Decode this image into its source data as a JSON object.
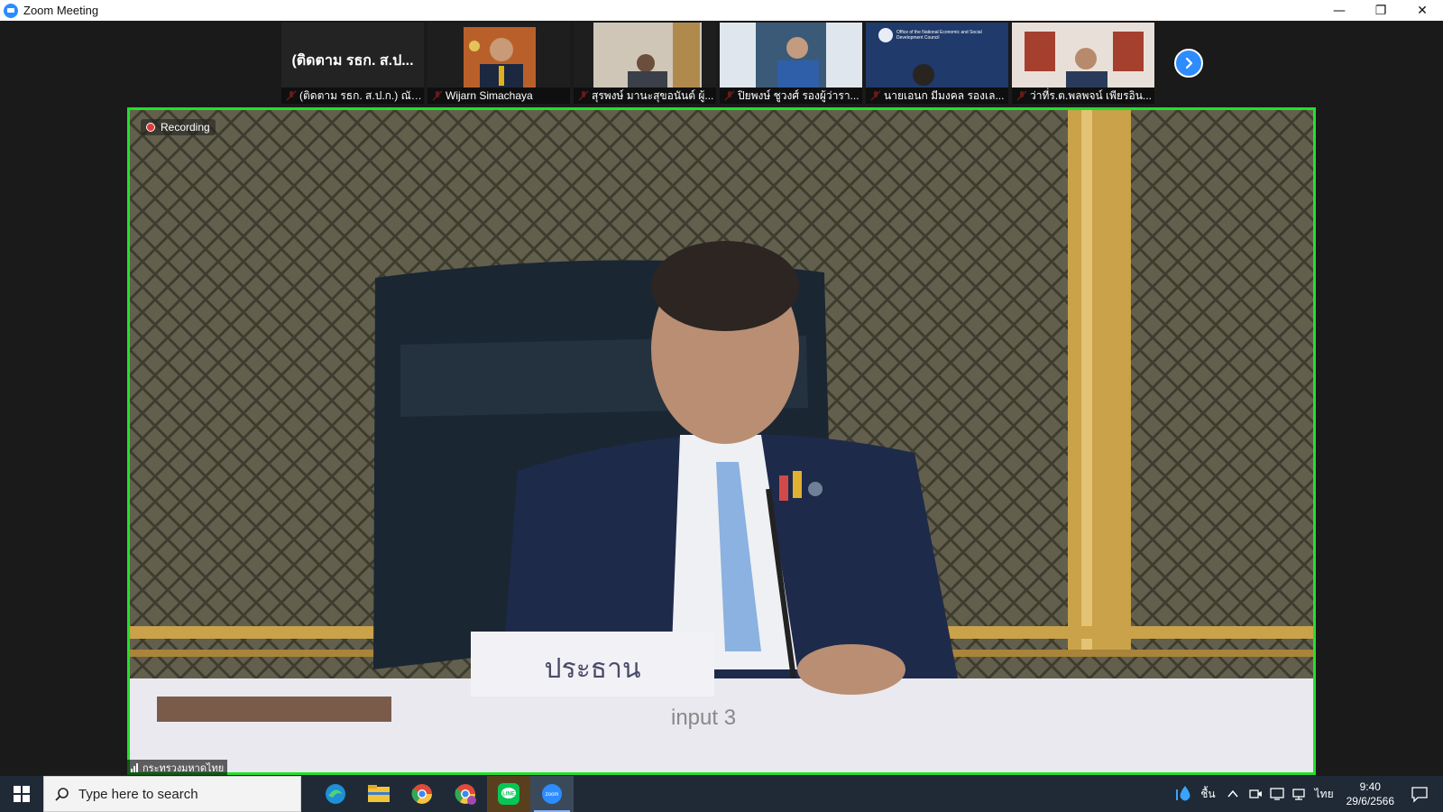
{
  "window": {
    "title": "Zoom Meeting",
    "minimize_glyph": "—",
    "restore_glyph": "❐",
    "close_glyph": "✕"
  },
  "thumbnails": [
    {
      "name_overlay": "(ติดตาม รธก. ส.ป...",
      "label": "(ติดตาม รธก. ส.ป.ก.) ณัฐ...",
      "muted": true,
      "video": false
    },
    {
      "label": "Wijarn Simachaya",
      "muted": true,
      "video": true
    },
    {
      "label": "สุรพงษ์ มานะสุขอนันต์ ผู้...",
      "muted": true,
      "video": true
    },
    {
      "label": "ปิยพงษ์ ชูวงศ์ รองผู้ว่ารา...",
      "muted": true,
      "video": true
    },
    {
      "label": "นายเอนก มีมงคล รองเล...",
      "muted": true,
      "video": true,
      "banner": "Office of the National Economic and Social Development Council"
    },
    {
      "label": "ว่าที่ร.ต.พลพจน์ เพียรอิน...",
      "muted": true,
      "video": true
    }
  ],
  "main_video": {
    "recording_label": "Recording",
    "speaker_name": "กระทรวงมหาดไทย",
    "nameplate": "ประธาน",
    "overlay_text": "input 3",
    "border_color": "#23e02b"
  },
  "taskbar": {
    "search_placeholder": "Type here to search",
    "apps": [
      "edge-icon",
      "file-explorer-icon",
      "chrome-icon",
      "chrome-profile-icon",
      "line-icon",
      "zoom-icon"
    ],
    "tray": {
      "weather": "ชื้น",
      "language": "ไทย",
      "time": "9:40",
      "date": "29/6/2566"
    }
  }
}
